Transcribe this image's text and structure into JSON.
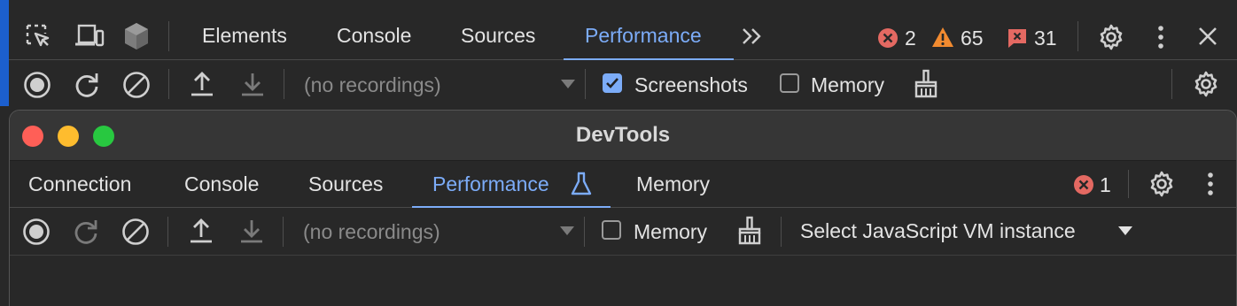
{
  "outer": {
    "tabs": [
      {
        "label": "Elements"
      },
      {
        "label": "Console"
      },
      {
        "label": "Sources"
      },
      {
        "label": "Performance",
        "active": true
      }
    ],
    "errors_count": "2",
    "warnings_count": "65",
    "issues_count": "31",
    "recordings_placeholder": "(no recordings)",
    "screenshots_label": "Screenshots",
    "screenshots_checked": true,
    "memory_label": "Memory",
    "memory_checked": false
  },
  "window": {
    "title": "DevTools",
    "tabs": [
      {
        "label": "Connection"
      },
      {
        "label": "Console"
      },
      {
        "label": "Sources"
      },
      {
        "label": "Performance",
        "active": true
      },
      {
        "label": "Memory"
      }
    ],
    "errors_count": "1",
    "recordings_placeholder": "(no recordings)",
    "memory_label": "Memory",
    "memory_checked": false,
    "vm_select_label": "Select JavaScript VM instance"
  },
  "colors": {
    "accent": "#7cacf8",
    "error": "#e46962",
    "warning": "#f28b30",
    "issue": "#e46962",
    "close": "#ff5f57",
    "minimize": "#febc2e",
    "zoom": "#28c840"
  }
}
